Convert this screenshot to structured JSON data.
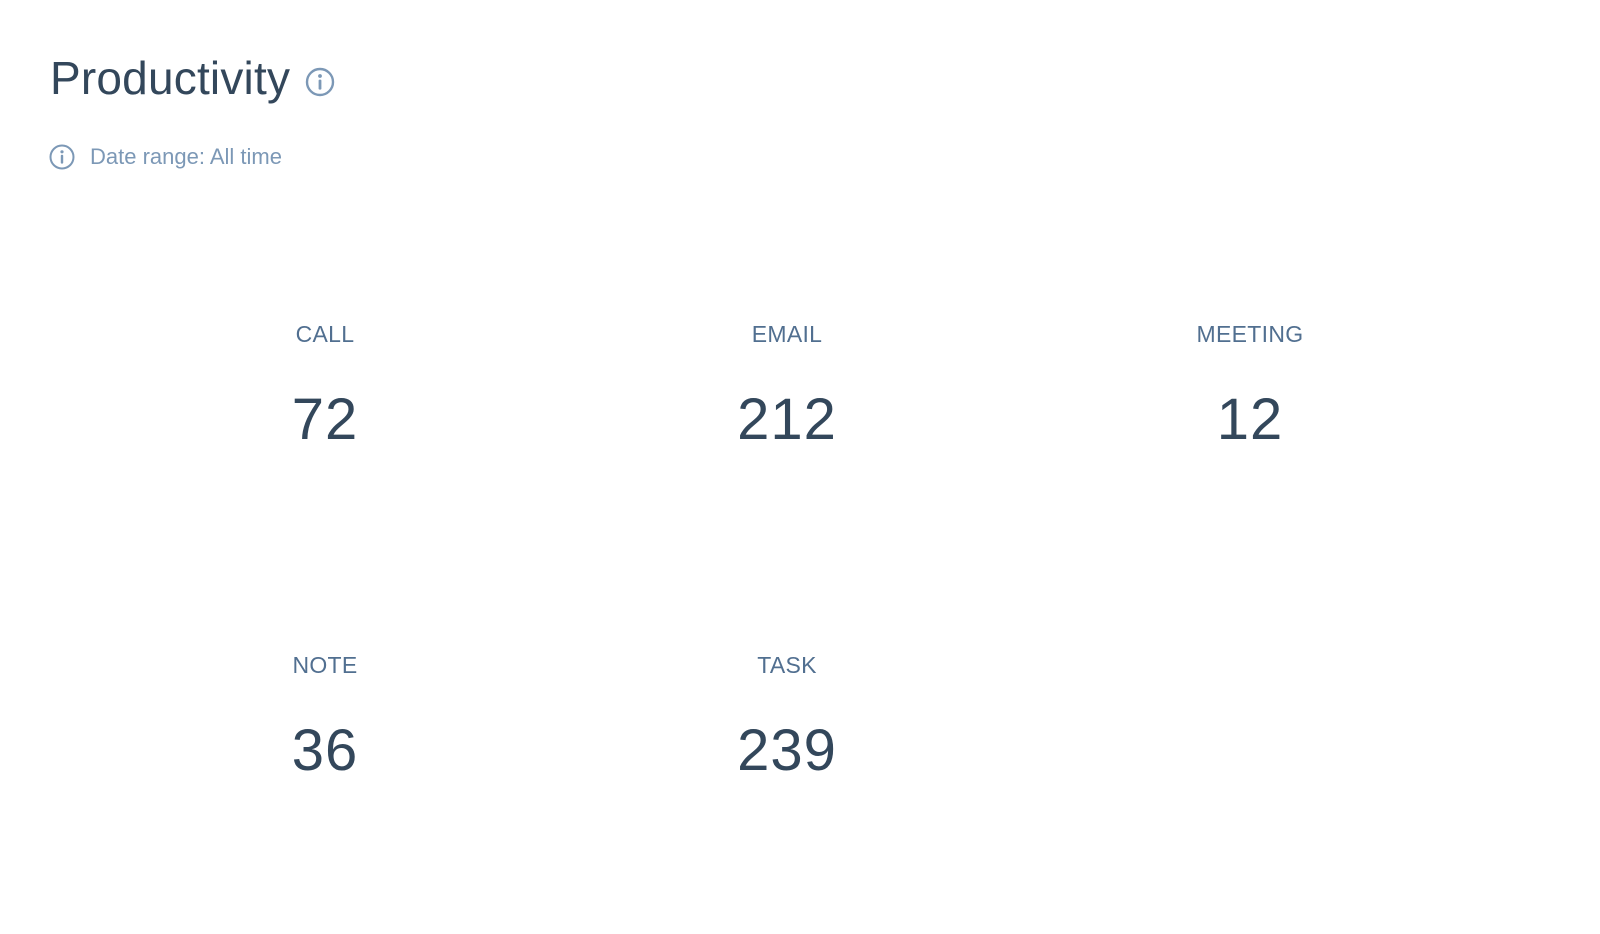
{
  "header": {
    "title": "Productivity"
  },
  "date_range": {
    "text": "Date range: All time"
  },
  "stats": [
    {
      "label": "CALL",
      "value": "72"
    },
    {
      "label": "EMAIL",
      "value": "212"
    },
    {
      "label": "MEETING",
      "value": "12"
    },
    {
      "label": "NOTE",
      "value": "36"
    },
    {
      "label": "TASK",
      "value": "239"
    }
  ],
  "icons": {
    "title_info": "info-icon",
    "date_info": "info-icon"
  },
  "colors": {
    "title": "#33475b",
    "label": "#516f90",
    "muted": "#7c98b6"
  }
}
